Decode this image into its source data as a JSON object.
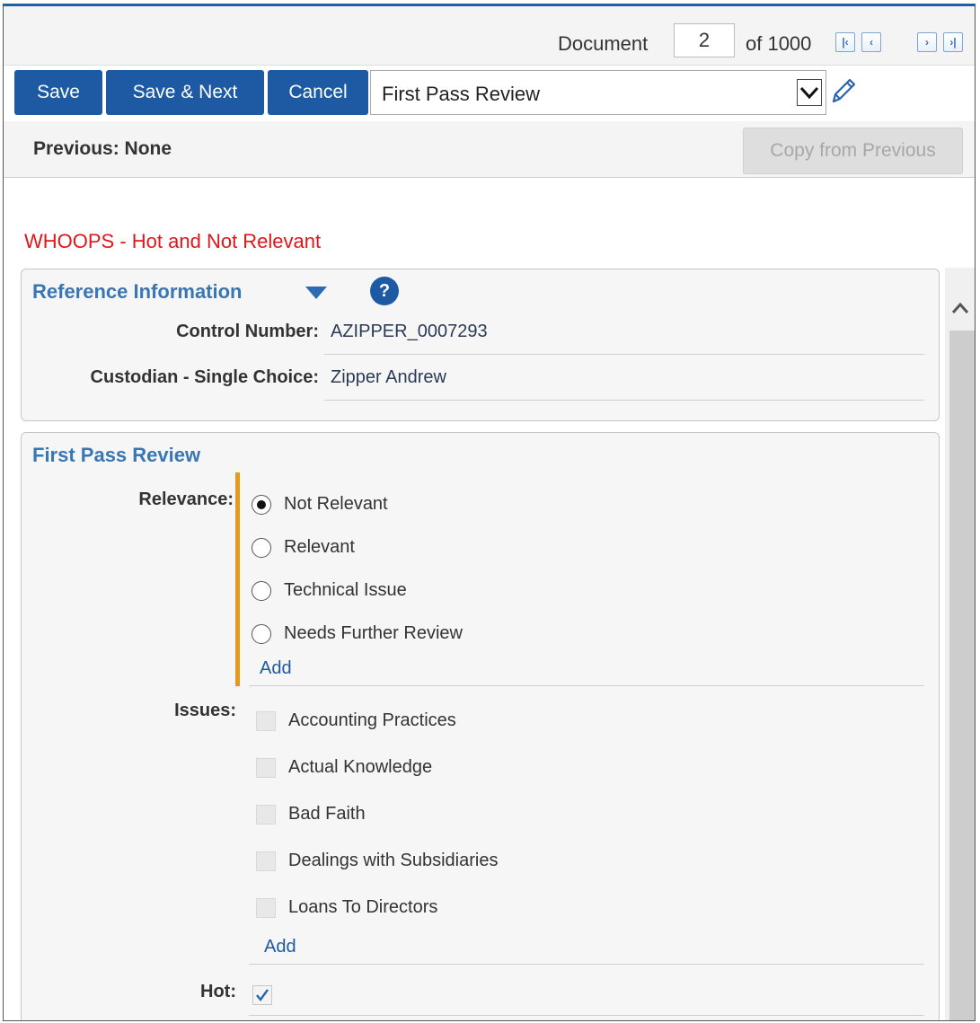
{
  "document_nav": {
    "label": "Document",
    "current": "2",
    "total_label": "of 1000",
    "buttons": {
      "first": "first-page",
      "prev": "prev-page",
      "next": "next-page",
      "last": "last-page"
    }
  },
  "toolbar": {
    "save_label": "Save",
    "save_next_label": "Save & Next",
    "cancel_label": "Cancel",
    "layout_selected": "First Pass Review",
    "edit_icon": "pencil-icon"
  },
  "previous": {
    "label": "Previous: None",
    "copy_button": "Copy from Previous"
  },
  "warning_text": "WHOOPS - Hot and Not Relevant",
  "reference_panel": {
    "title": "Reference Information",
    "fields": [
      {
        "label": "Control Number:",
        "value": "AZIPPER_0007293"
      },
      {
        "label": "Custodian - Single Choice:",
        "value": "Zipper Andrew"
      }
    ]
  },
  "first_pass_panel": {
    "title": "First Pass Review",
    "relevance": {
      "label": "Relevance:",
      "options": [
        "Not Relevant",
        "Relevant",
        "Technical Issue",
        "Needs Further Review"
      ],
      "selected": "Not Relevant",
      "add_label": "Add"
    },
    "issues": {
      "label": "Issues:",
      "options": [
        "Accounting Practices",
        "Actual Knowledge",
        "Bad Faith",
        "Dealings with Subsidiaries",
        "Loans To Directors"
      ],
      "add_label": "Add"
    },
    "hot": {
      "label": "Hot:",
      "checked": true
    }
  },
  "colors": {
    "primary": "#1d5aa3",
    "warning": "#e0161b",
    "section_title": "#3876b4",
    "required_bar": "#e59a1c"
  }
}
